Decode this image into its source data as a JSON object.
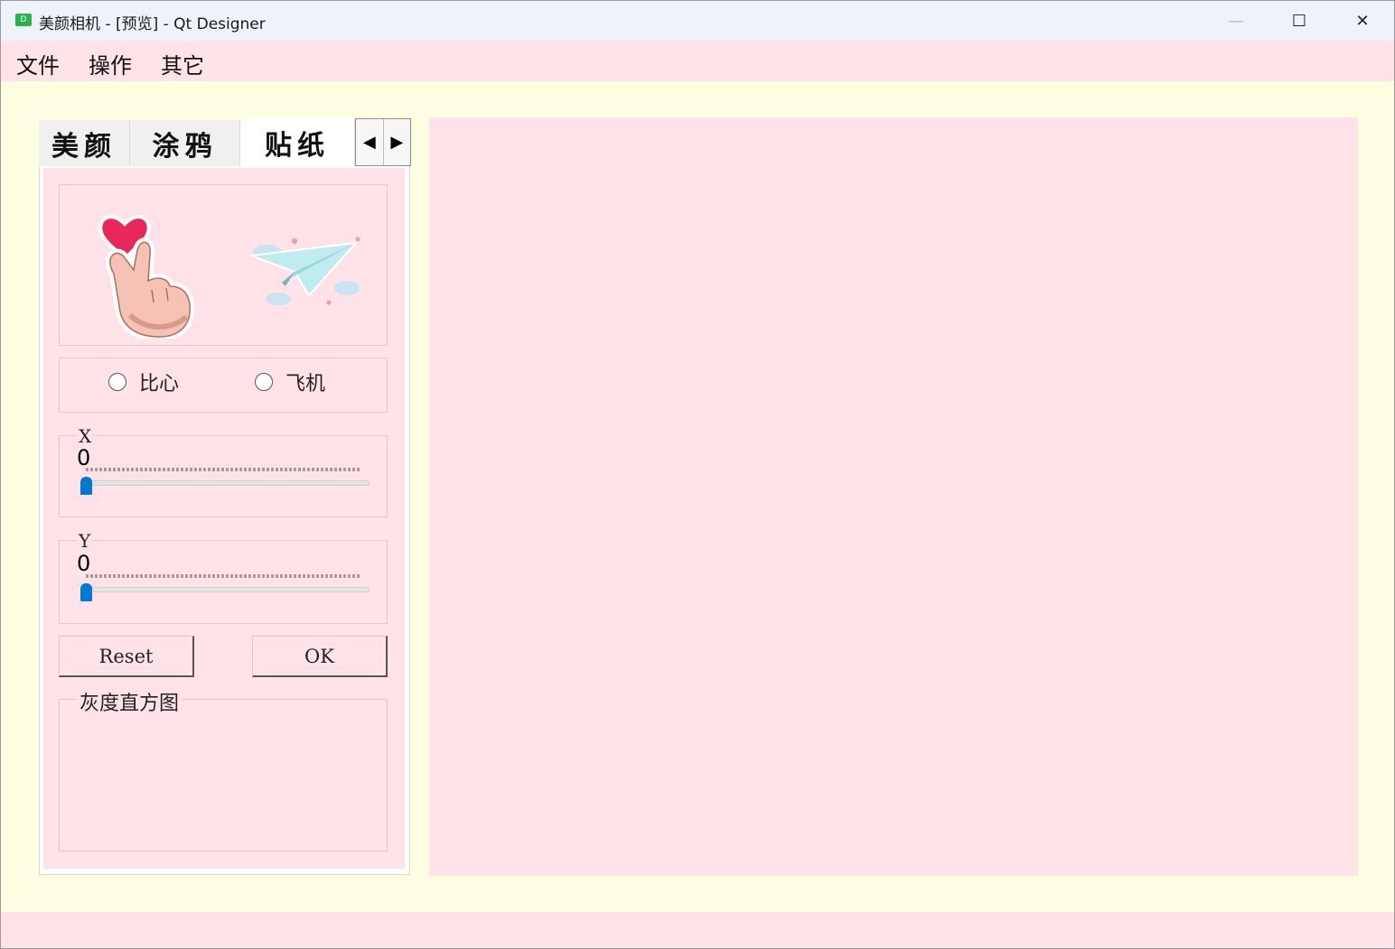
{
  "window": {
    "title": "美颜相机 - [预览] - Qt Designer",
    "icon_letter": "D",
    "minimize": "—",
    "maximize": "☐",
    "close": "✕"
  },
  "menu": {
    "items": [
      "文件",
      "操作",
      "其它"
    ]
  },
  "tabs": {
    "items": [
      "美颜",
      "涂鸦",
      "贴纸"
    ],
    "active": "贴纸",
    "scroll_left": "◀",
    "scroll_right": "▶"
  },
  "stickers": {
    "images": [
      "heart-finger-sticker",
      "paper-plane-sticker"
    ],
    "options": [
      "比心",
      "飞机"
    ]
  },
  "slider_x": {
    "title": "X",
    "value": "0",
    "position": 0
  },
  "slider_y": {
    "title": "Y",
    "value": "0",
    "position": 0
  },
  "buttons": {
    "reset": "Reset",
    "ok": "OK"
  },
  "histogram": {
    "title": "灰度直方图"
  },
  "colors": {
    "background": "#fefee2",
    "panel": "#ffe3e8",
    "accent": "#0078d4"
  }
}
